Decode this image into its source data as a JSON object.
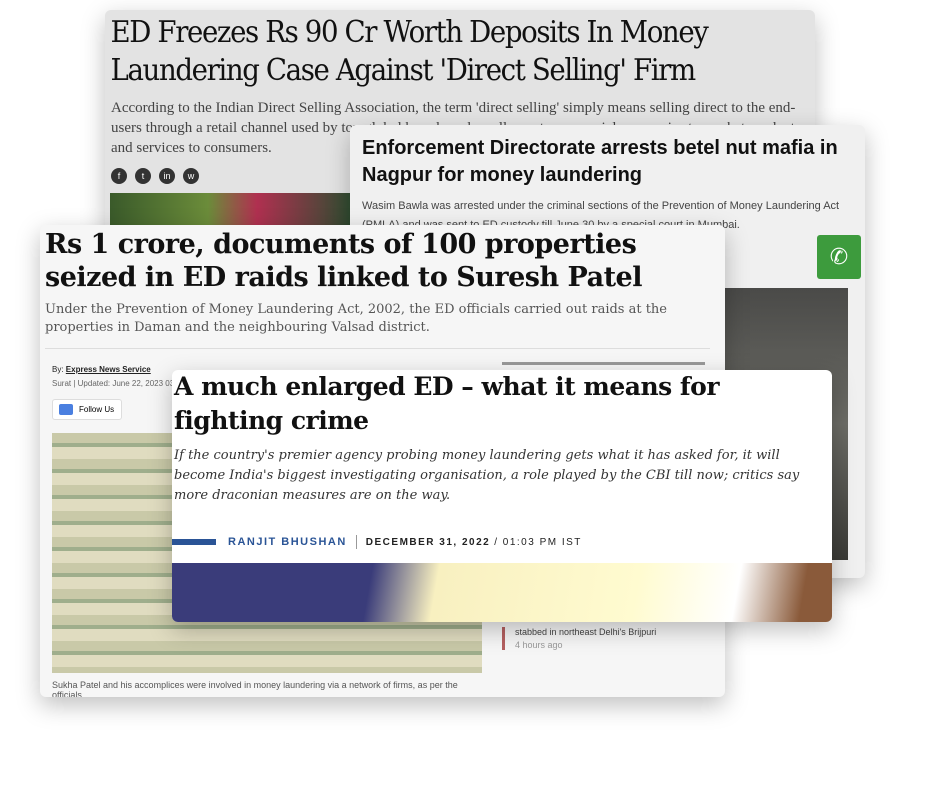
{
  "card1": {
    "headline": "ED Freezes Rs 90 Cr Worth Deposits In Money Laundering Case Against 'Direct Selling' Firm",
    "summary": "According to the Indian Direct Selling Association, the term 'direct selling' simply means selling direct to the end-users through a retail channel used by top global brands and smaller, entrepreneurial companies to market products and services to consumers.",
    "social": [
      "f",
      "t",
      "in",
      "w"
    ]
  },
  "card2": {
    "headline": "Enforcement Directorate arrests betel nut mafia in Nagpur for money laundering",
    "summary": "Wasim Bawla was arrested under the criminal sections of the Prevention of Money Laundering Act (PMLA) and was sent to ED custody till June 30 by a special court in Mumbai.",
    "whatsapp": "✆"
  },
  "card3": {
    "headline": "Rs 1 crore, documents of 100 properties seized in ED raids linked to Suresh Patel",
    "summary": "Under the Prevention of Money Laundering Act, 2002, the ED officials carried out raids at the properties in Daman and the neighbouring Valsad district.",
    "by_label": "By:",
    "author": "Express News Service",
    "updated": "Surat | Updated: June 22, 2023 03",
    "follow": "Follow Us",
    "caption": "Sukha Patel and his accomplices were involved in money laundering via a network of firms, as per the officials",
    "side_news": "stabbed in northeast Delhi's Brijpuri",
    "side_time": "4 hours ago"
  },
  "card4": {
    "headline": "A much enlarged ED – what it means for fighting crime",
    "summary": "If the country's premier agency probing money laundering gets what it has asked for, it will become India's biggest investigating organisation, a role played by the CBI till now; critics say more draconian measures are on the way.",
    "author": "RANJIT BHUSHAN",
    "date": "DECEMBER 31, 2022",
    "time": "/ 01:03 PM IST"
  }
}
